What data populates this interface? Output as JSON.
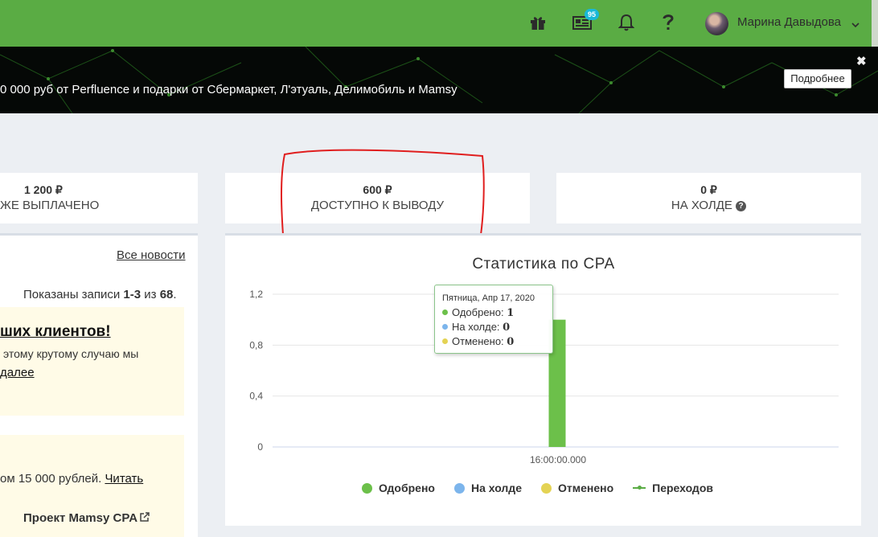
{
  "topbar": {
    "icons": [
      "gift-icon",
      "news-icon",
      "bell-icon",
      "help-icon"
    ],
    "news_badge": "95",
    "user_name": "Марина Давыдова",
    "color": "#5aac44"
  },
  "banner": {
    "text": "0 000 руб от Perfluence и подарки от Сбермаркет, Л'этуаль, Делимобиль и Mamsy",
    "button_label": "Подробнее",
    "close_label": "✖"
  },
  "stats": {
    "paid": {
      "amount": "1 200 ₽",
      "label": "ЖЕ ВЫПЛАЧЕНО"
    },
    "available": {
      "amount": "600 ₽",
      "label": "ДОСТУПНО К ВЫВОДУ"
    },
    "hold": {
      "amount": "0 ₽",
      "label": "НА ХОЛДЕ",
      "help": "?"
    }
  },
  "news": {
    "all_news_label": "Все новости",
    "shown_prefix": "Показаны записи ",
    "shown_range": "1-3",
    "shown_of": " из ",
    "shown_total": "68",
    "shown_suffix": ".",
    "item1": {
      "title": "ших клиентов!",
      "text": "этому крутому случаю мы",
      "more": "далее"
    },
    "item2": {
      "text": "ом 15 000 рублей. ",
      "link": "Читать",
      "project": "Проект Mamsy CPA"
    }
  },
  "chart_data": {
    "type": "bar",
    "title": "Статистика по CPA",
    "categories": [
      "16:00:00.000"
    ],
    "series": [
      {
        "name": "Одобрено",
        "values": [
          1
        ],
        "color": "#6cc04a"
      },
      {
        "name": "На холде",
        "values": [
          0
        ],
        "color": "#7cb5ec"
      },
      {
        "name": "Отменено",
        "values": [
          0
        ],
        "color": "#e4d354"
      },
      {
        "name": "Переходов",
        "values": [
          0
        ],
        "color": "#5aac44",
        "style": "line"
      }
    ],
    "yticks": [
      "0",
      "0,4",
      "0,8",
      "1,2"
    ],
    "ylim": [
      0,
      1.2
    ],
    "grid": true,
    "legend": "bottom",
    "tooltip": {
      "date": "Пятница, Апр 17, 2020",
      "rows": [
        {
          "label": "Одобрено: ",
          "value": "1",
          "color": "#6cc04a"
        },
        {
          "label": "На холде: ",
          "value": "0",
          "color": "#7cb5ec"
        },
        {
          "label": "Отменено: ",
          "value": "0",
          "color": "#e4d354"
        }
      ]
    }
  }
}
